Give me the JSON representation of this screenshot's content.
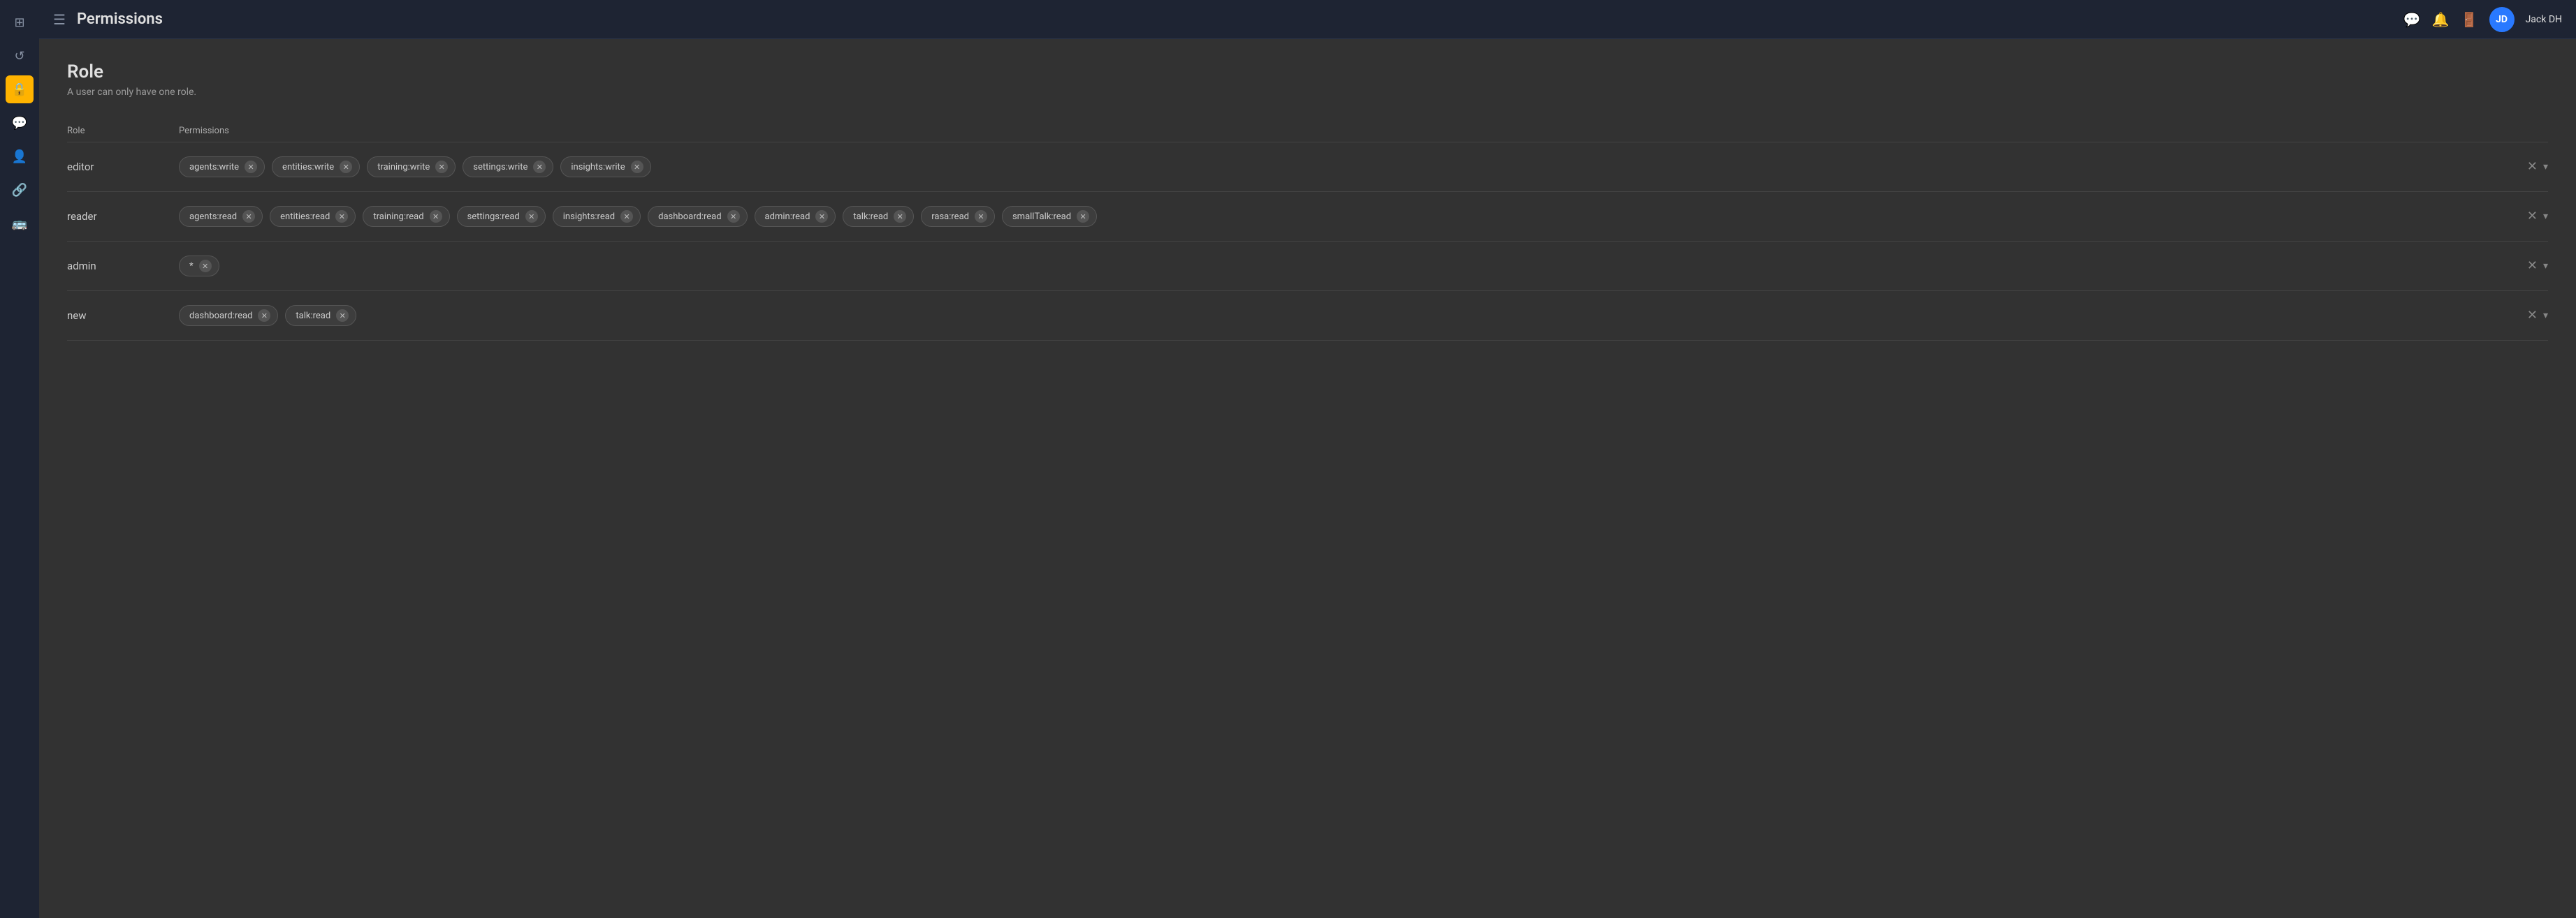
{
  "header": {
    "menu_label": "☰",
    "title": "Permissions",
    "icons": [
      "chat-icon",
      "bell-icon",
      "logout-icon"
    ],
    "avatar_label": "JD",
    "username": "Jack DH"
  },
  "sidebar": {
    "items": [
      {
        "id": "grid-icon",
        "symbol": "⊞"
      },
      {
        "id": "refresh-icon",
        "symbol": "↺"
      },
      {
        "id": "lock-icon",
        "symbol": "🔒"
      },
      {
        "id": "chat-icon",
        "symbol": "💬"
      },
      {
        "id": "users-icon",
        "symbol": "👤"
      },
      {
        "id": "link-icon",
        "symbol": "🔗"
      },
      {
        "id": "bus-icon",
        "symbol": "🚌"
      }
    ]
  },
  "page": {
    "title": "Role",
    "subtitle": "A user can only have one role.",
    "table": {
      "col_role": "Role",
      "col_perms": "Permissions",
      "rows": [
        {
          "role": "editor",
          "permissions": [
            "agents:write",
            "entities:write",
            "training:write",
            "settings:write",
            "insights:write"
          ]
        },
        {
          "role": "reader",
          "permissions": [
            "agents:read",
            "entities:read",
            "training:read",
            "settings:read",
            "insights:read",
            "dashboard:read",
            "admin:read",
            "talk:read",
            "rasa:read",
            "smallTalk:read"
          ]
        },
        {
          "role": "admin",
          "permissions": [
            "*"
          ]
        },
        {
          "role": "new",
          "permissions": [
            "dashboard:read",
            "talk:read"
          ]
        }
      ]
    }
  }
}
